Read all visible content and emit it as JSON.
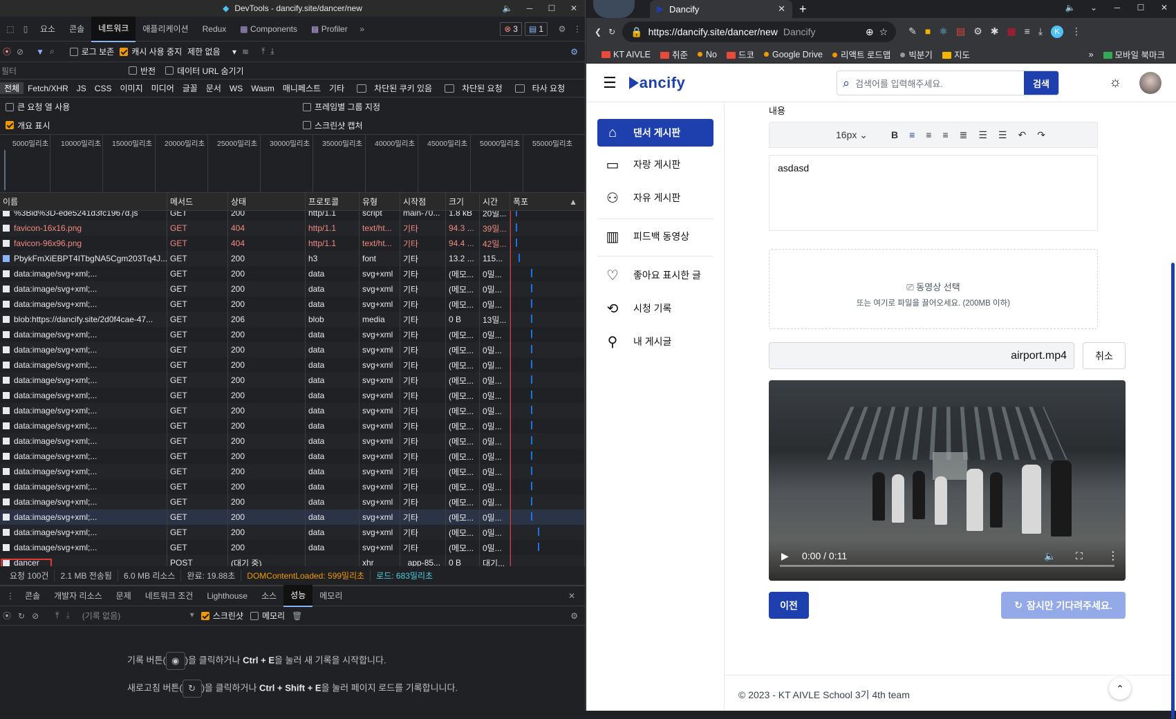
{
  "devtools": {
    "title": "DevTools - dancify.site/dancer/new",
    "tabs": [
      "요소",
      "콘솔",
      "네트워크",
      "애플리케이션",
      "Redux",
      "Components",
      "Profiler"
    ],
    "errors": "3",
    "messages": "1",
    "toolbar": {
      "preserve_log": "로그 보존",
      "disable_cache": "캐시 사용 중지",
      "throttle": "제한 없음"
    },
    "filter": {
      "placeholder": "필터",
      "invert": "반전",
      "hide_data_urls": "데이터 URL 숨기기"
    },
    "types": [
      "전체",
      "Fetch/XHR",
      "JS",
      "CSS",
      "이미지",
      "미디어",
      "글꼴",
      "문서",
      "WS",
      "Wasm",
      "매니페스트",
      "기타"
    ],
    "blocked_cookies": "차단된 쿠키 있음",
    "blocked_requests": "차단된 요청",
    "third_party": "타사 요청",
    "big_rows": "큰 요청 열 사용",
    "group_by_frame": "프레임별 그룹 지정",
    "overview": "개요 표시",
    "screenshots": "스크린샷 캡처",
    "timeline_labels": [
      "5000밀리초",
      "10000밀리초",
      "15000밀리초",
      "20000밀리초",
      "25000밀리초",
      "30000밀리초",
      "35000밀리초",
      "40000밀리초",
      "45000밀리초",
      "50000밀리초",
      "55000밀리초"
    ],
    "columns": [
      "이름",
      "메서드",
      "상태",
      "프로토콜",
      "유형",
      "시작점",
      "크기",
      "시간",
      "폭포"
    ],
    "requests": [
      {
        "name": "%3Bid%3D-ede5241d3fc1967d.js",
        "method": "GET",
        "status": "200",
        "proto": "http/1.1",
        "type": "script",
        "init": "main-70...",
        "size": "1.8 kB",
        "time": "20밀...",
        "red": false
      },
      {
        "name": "favicon-16x16.png",
        "method": "GET",
        "status": "404",
        "proto": "http/1.1",
        "type": "text/ht...",
        "init": "기타",
        "size": "94.3 ...",
        "time": "39밀...",
        "red": true
      },
      {
        "name": "favicon-96x96.png",
        "method": "GET",
        "status": "404",
        "proto": "http/1.1",
        "type": "text/ht...",
        "init": "기타",
        "size": "94.4 ...",
        "time": "42밀...",
        "red": true
      },
      {
        "name": "PbykFmXiEBPT4ITbgNA5Cgm203Tq4J...",
        "method": "GET",
        "status": "200",
        "proto": "h3",
        "type": "font",
        "init": "기타",
        "size": "13.2 ...",
        "time": "115...",
        "red": false
      },
      {
        "name": "data:image/svg+xml;...",
        "method": "GET",
        "status": "200",
        "proto": "data",
        "type": "svg+xml",
        "init": "기타",
        "size": "(메모...",
        "time": "0밀...",
        "red": false
      },
      {
        "name": "data:image/svg+xml;...",
        "method": "GET",
        "status": "200",
        "proto": "data",
        "type": "svg+xml",
        "init": "기타",
        "size": "(메모...",
        "time": "0밀...",
        "red": false
      },
      {
        "name": "data:image/svg+xml;...",
        "method": "GET",
        "status": "200",
        "proto": "data",
        "type": "svg+xml",
        "init": "기타",
        "size": "(메모...",
        "time": "0밀...",
        "red": false
      },
      {
        "name": "blob:https://dancify.site/2d0f4cae-47...",
        "method": "GET",
        "status": "206",
        "proto": "blob",
        "type": "media",
        "init": "기타",
        "size": "0 B",
        "time": "13밀...",
        "red": false
      },
      {
        "name": "data:image/svg+xml;...",
        "method": "GET",
        "status": "200",
        "proto": "data",
        "type": "svg+xml",
        "init": "기타",
        "size": "(메모...",
        "time": "0밀...",
        "red": false
      },
      {
        "name": "data:image/svg+xml;...",
        "method": "GET",
        "status": "200",
        "proto": "data",
        "type": "svg+xml",
        "init": "기타",
        "size": "(메모...",
        "time": "0밀...",
        "red": false
      },
      {
        "name": "data:image/svg+xml;...",
        "method": "GET",
        "status": "200",
        "proto": "data",
        "type": "svg+xml",
        "init": "기타",
        "size": "(메모...",
        "time": "0밀...",
        "red": false
      },
      {
        "name": "data:image/svg+xml;...",
        "method": "GET",
        "status": "200",
        "proto": "data",
        "type": "svg+xml",
        "init": "기타",
        "size": "(메모...",
        "time": "0밀...",
        "red": false
      },
      {
        "name": "data:image/svg+xml;...",
        "method": "GET",
        "status": "200",
        "proto": "data",
        "type": "svg+xml",
        "init": "기타",
        "size": "(메모...",
        "time": "0밀...",
        "red": false
      },
      {
        "name": "data:image/svg+xml;...",
        "method": "GET",
        "status": "200",
        "proto": "data",
        "type": "svg+xml",
        "init": "기타",
        "size": "(메모...",
        "time": "0밀...",
        "red": false
      },
      {
        "name": "data:image/svg+xml;...",
        "method": "GET",
        "status": "200",
        "proto": "data",
        "type": "svg+xml",
        "init": "기타",
        "size": "(메모...",
        "time": "0밀...",
        "red": false
      },
      {
        "name": "data:image/svg+xml;...",
        "method": "GET",
        "status": "200",
        "proto": "data",
        "type": "svg+xml",
        "init": "기타",
        "size": "(메모...",
        "time": "0밀...",
        "red": false
      },
      {
        "name": "data:image/svg+xml;...",
        "method": "GET",
        "status": "200",
        "proto": "data",
        "type": "svg+xml",
        "init": "기타",
        "size": "(메모...",
        "time": "0밀...",
        "red": false
      },
      {
        "name": "data:image/svg+xml;...",
        "method": "GET",
        "status": "200",
        "proto": "data",
        "type": "svg+xml",
        "init": "기타",
        "size": "(메모...",
        "time": "0밀...",
        "red": false
      },
      {
        "name": "data:image/svg+xml;...",
        "method": "GET",
        "status": "200",
        "proto": "data",
        "type": "svg+xml",
        "init": "기타",
        "size": "(메모...",
        "time": "0밀...",
        "red": false
      },
      {
        "name": "data:image/svg+xml;...",
        "method": "GET",
        "status": "200",
        "proto": "data",
        "type": "svg+xml",
        "init": "기타",
        "size": "(메모...",
        "time": "0밀...",
        "red": false
      },
      {
        "name": "data:image/svg+xml;...",
        "method": "GET",
        "status": "200",
        "proto": "data",
        "type": "svg+xml",
        "init": "기타",
        "size": "(메모...",
        "time": "0밀...",
        "red": false,
        "selected": true
      },
      {
        "name": "data:image/svg+xml;...",
        "method": "GET",
        "status": "200",
        "proto": "data",
        "type": "svg+xml",
        "init": "기타",
        "size": "(메모...",
        "time": "0밀...",
        "red": false
      },
      {
        "name": "data:image/svg+xml;...",
        "method": "GET",
        "status": "200",
        "proto": "data",
        "type": "svg+xml",
        "init": "기타",
        "size": "(메모...",
        "time": "0밀...",
        "red": false
      },
      {
        "name": "dancer",
        "method": "POST",
        "status": "(대기 중)",
        "proto": "",
        "type": "xhr",
        "init": "_app-85...",
        "size": "0 B",
        "time": "대기...",
        "red": false
      }
    ],
    "status_bar": [
      "요청 100건",
      "2.1 MB 전송됨",
      "6.0 MB 리소스",
      "완료: 19.88초",
      "DOMContentLoaded: 599밀리초",
      "로드: 683밀리초"
    ],
    "drawer_tabs": [
      "콘솔",
      "개발자 리소스",
      "문제",
      "네트워크 조건",
      "Lighthouse",
      "소스",
      "성능",
      "메모리"
    ],
    "perf": {
      "select": "(기록 없음)",
      "screenshots": "스크린샷",
      "memory": "메모리",
      "line1_a": "기록 버튼(",
      "line1_b": ")을 클릭하거나 ",
      "line1_key": "Ctrl + E",
      "line1_c": "을 눌러 새 기록을 시작합니다.",
      "line2_a": "새로고침 버튼(",
      "line2_b": ")을 클릭하거나 ",
      "line2_key": "Ctrl + Shift + E",
      "line2_c": "을 눌러 페이지 로드를 기록합니니다."
    }
  },
  "browser": {
    "tab_title": "Dancify",
    "url": "https://dancify.site/dancer/new",
    "url_title": "Dancify",
    "bookmarks": [
      "KT AIVLE",
      "취준",
      "No",
      "드코",
      "Google Drive",
      "리액트 로드맵",
      "빅분기",
      "지도"
    ],
    "mobile_bookmarks": "모바일 북마크",
    "profile_initial": "K"
  },
  "site": {
    "logo": "ancify",
    "search_placeholder": "검색어를 입력해주세요.",
    "search_button": "검색",
    "nav": [
      "댄서 게시판",
      "자랑 게시판",
      "자유 게시판",
      "피드백 동영상",
      "좋아요 표시한 글",
      "시청 기록",
      "내 게시글"
    ],
    "content_label": "내용",
    "font_size": "16px",
    "editor_text": "asdasd",
    "video_select": "동영상 선택",
    "video_hint": "또는 여기로 파일을 끌어오세요. (200MB 이하)",
    "file_name": "airport.mp4",
    "cancel": "취소",
    "video_time": "0:00 / 0:11",
    "prev": "이전",
    "wait": "잠시만 기다려주세요.",
    "footer": "© 2023 - KT AIVLE School 3기 4th team"
  }
}
